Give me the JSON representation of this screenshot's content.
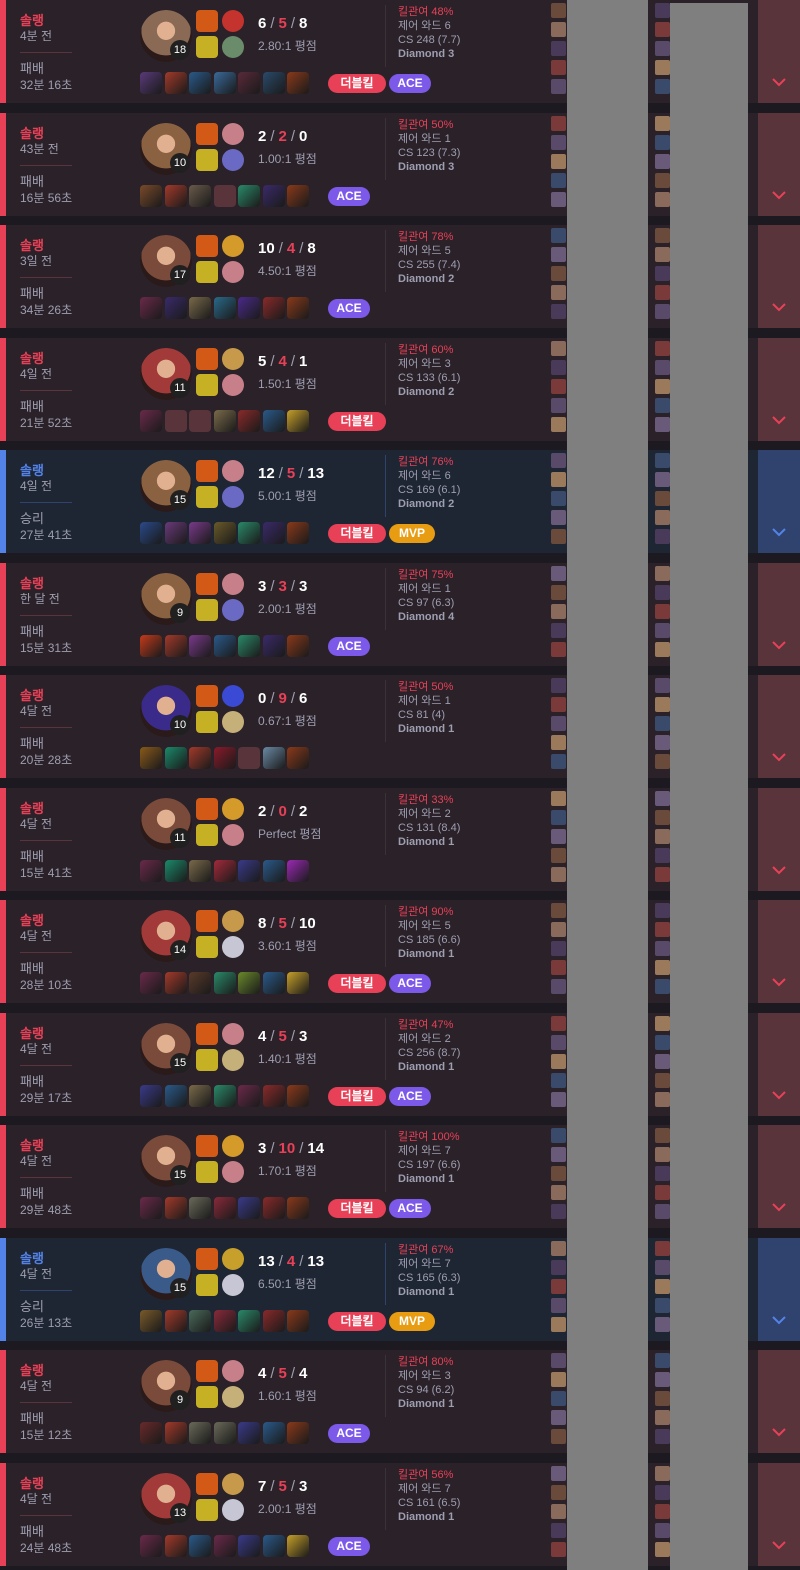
{
  "colors": {
    "loss": "#e84057",
    "win": "#5383e8",
    "kda_death": "#e84057",
    "ace_badge": "#7d59ea",
    "mvp_badge": "#e89c12"
  },
  "matches": [
    {
      "queue": "솔랭",
      "ago": "4분 전",
      "result": "패배",
      "win": false,
      "duration": "32분 16초",
      "champ_color": "#8a6a55",
      "champ_icon": "champion-portrait-icon",
      "level": "18",
      "kills": "6",
      "deaths": "5",
      "assists": "8",
      "ratio": "2.80:1 평점",
      "kill_part": "킬관여 48%",
      "wards": "제어 와드 6",
      "cs": "CS 248 (7.7)",
      "tier": "Diamond 3",
      "items": [
        "#5a3a7a",
        "#a33a2a",
        "#2a5a8a",
        "#3a6a9a",
        "#5a2a3a",
        "#2a4a6a",
        "#8a3a1a"
      ],
      "empty_items": [],
      "spells": [
        "#d25a16",
        "#c6b024"
      ],
      "runes": [
        "#c4332e",
        "#6b8c6a"
      ],
      "badges": [
        {
          "label": "더블킬",
          "style": "red"
        },
        {
          "label": "ACE",
          "style": "purple"
        }
      ]
    },
    {
      "queue": "솔랭",
      "ago": "43분 전",
      "result": "패배",
      "win": false,
      "duration": "16분 56초",
      "champ_color": "#8a6242",
      "champ_icon": "champion-portrait-icon",
      "level": "10",
      "kills": "2",
      "deaths": "2",
      "assists": "0",
      "ratio": "1.00:1 평점",
      "kill_part": "킬관여 50%",
      "wards": "제어 와드 1",
      "cs": "CS 123 (7.3)",
      "tier": "Diamond 3",
      "items": [
        "#7a4a2a",
        "#a33a2a",
        "#6a5a4a",
        null,
        "#2a8a6a",
        "#3a2a6a",
        "#8a3a1a"
      ],
      "empty_items": [
        3
      ],
      "spells": [
        "#d25a16",
        "#c6b024"
      ],
      "runes": [
        "#c7808a",
        "#6a6ac4"
      ],
      "badges": [
        {
          "label": "ACE",
          "style": "purple"
        }
      ]
    },
    {
      "queue": "솔랭",
      "ago": "3일 전",
      "result": "패배",
      "win": false,
      "duration": "34분 26초",
      "champ_color": "#7a4a3a",
      "champ_icon": "champion-portrait-icon",
      "level": "17",
      "kills": "10",
      "deaths": "4",
      "assists": "8",
      "ratio": "4.50:1 평점",
      "kill_part": "킬관여 78%",
      "wards": "제어 와드 5",
      "cs": "CS 255 (7.4)",
      "tier": "Diamond 2",
      "items": [
        "#6a2a4a",
        "#3a2a6a",
        "#7a6a4a",
        "#2a6a8a",
        "#4a2a8a",
        "#8a2a2a",
        "#8a3a1a"
      ],
      "empty_items": [],
      "spells": [
        "#d25a16",
        "#c6b024"
      ],
      "runes": [
        "#d49a2a",
        "#c7808a"
      ],
      "badges": [
        {
          "label": "ACE",
          "style": "purple"
        }
      ]
    },
    {
      "queue": "솔랭",
      "ago": "4일 전",
      "result": "패배",
      "win": false,
      "duration": "21분 52초",
      "champ_color": "#a33a3a",
      "champ_icon": "champion-portrait-icon",
      "level": "11",
      "kills": "5",
      "deaths": "4",
      "assists": "1",
      "ratio": "1.50:1 평점",
      "kill_part": "킬관여 60%",
      "wards": "제어 와드 3",
      "cs": "CS 133 (6.1)",
      "tier": "Diamond 2",
      "items": [
        "#6a2a4a",
        null,
        null,
        "#7a6a4a",
        "#8a2a2a",
        "#2a5a8a",
        "#c6a02a"
      ],
      "empty_items": [
        1,
        2
      ],
      "spells": [
        "#d25a16",
        "#c6b024"
      ],
      "runes": [
        "#c69a4a",
        "#c7808a"
      ],
      "badges": [
        {
          "label": "더블킬",
          "style": "red"
        }
      ]
    },
    {
      "queue": "솔랭",
      "ago": "4일 전",
      "result": "승리",
      "win": true,
      "duration": "27분 41초",
      "champ_color": "#8a6242",
      "champ_icon": "champion-portrait-icon",
      "level": "15",
      "kills": "12",
      "deaths": "5",
      "assists": "13",
      "ratio": "5.00:1 평점",
      "kill_part": "킬관여 76%",
      "wards": "제어 와드 6",
      "cs": "CS 169 (6.1)",
      "tier": "Diamond 2",
      "items": [
        "#2a4a8a",
        "#6a3a7a",
        "#7a3a8a",
        "#6a5a2a",
        "#2a8a6a",
        "#3a2a6a",
        "#8a3a1a"
      ],
      "empty_items": [],
      "spells": [
        "#d25a16",
        "#c6b024"
      ],
      "runes": [
        "#c7808a",
        "#6a6ac4"
      ],
      "badges": [
        {
          "label": "더블킬",
          "style": "red"
        },
        {
          "label": "MVP",
          "style": "gold"
        }
      ]
    },
    {
      "queue": "솔랭",
      "ago": "한 달 전",
      "result": "패배",
      "win": false,
      "duration": "15분 31초",
      "champ_color": "#8a6242",
      "champ_icon": "champion-portrait-icon",
      "level": "9",
      "kills": "3",
      "deaths": "3",
      "assists": "3",
      "ratio": "2.00:1 평점",
      "kill_part": "킬관여 75%",
      "wards": "제어 와드 1",
      "cs": "CS 97 (6.3)",
      "tier": "Diamond 4",
      "items": [
        "#c43a1a",
        "#a33a2a",
        "#7a3a8a",
        "#2a5a8a",
        "#2a8a6a",
        "#3a2a6a",
        "#8a3a1a"
      ],
      "empty_items": [],
      "spells": [
        "#d25a16",
        "#c6b024"
      ],
      "runes": [
        "#c7808a",
        "#6a6ac4"
      ],
      "badges": [
        {
          "label": "ACE",
          "style": "purple"
        }
      ]
    },
    {
      "queue": "솔랭",
      "ago": "4달 전",
      "result": "패배",
      "win": false,
      "duration": "20분 28초",
      "champ_color": "#3a2a8a",
      "champ_icon": "champion-portrait-icon",
      "level": "10",
      "kills": "0",
      "deaths": "9",
      "assists": "6",
      "ratio": "0.67:1 평점",
      "kill_part": "킬관여 50%",
      "wards": "제어 와드 1",
      "cs": "CS 81 (4)",
      "tier": "Diamond 1",
      "items": [
        "#8a5a1a",
        "#1a8a6a",
        "#a33a2a",
        "#8a1a2a",
        null,
        "#6a8aa4",
        "#8a3a1a"
      ],
      "empty_items": [
        4
      ],
      "spells": [
        "#d25a16",
        "#c6b024"
      ],
      "runes": [
        "#3a4ad4",
        "#c6b07a"
      ],
      "badges": []
    },
    {
      "queue": "솔랭",
      "ago": "4달 전",
      "result": "패배",
      "win": false,
      "duration": "15분 41초",
      "champ_color": "#7a4a3a",
      "champ_icon": "champion-portrait-icon",
      "level": "11",
      "kills": "2",
      "deaths": "0",
      "assists": "2",
      "ratio": "Perfect 평점",
      "kill_part": "킬관여 33%",
      "wards": "제어 와드 2",
      "cs": "CS 131 (8.4)",
      "tier": "Diamond 1",
      "items": [
        "#6a2a4a",
        "#1a8a6a",
        "#7a6a4a",
        "#a32a3a",
        "#3a3a8a",
        "#2a5a8a",
        "#9a2ab4"
      ],
      "empty_items": [],
      "spells": [
        "#d25a16",
        "#c6b024"
      ],
      "runes": [
        "#d49a2a",
        "#c7808a"
      ],
      "badges": []
    },
    {
      "queue": "솔랭",
      "ago": "4달 전",
      "result": "패배",
      "win": false,
      "duration": "28분 10초",
      "champ_color": "#a33a3a",
      "champ_icon": "champion-portrait-icon",
      "level": "14",
      "kills": "8",
      "deaths": "5",
      "assists": "10",
      "ratio": "3.60:1 평점",
      "kill_part": "킬관여 90%",
      "wards": "제어 와드 5",
      "cs": "CS 185 (6.6)",
      "tier": "Diamond 1",
      "items": [
        "#6a2a4a",
        "#a33a2a",
        "#5a3a2a",
        "#2a8a6a",
        "#6a8a2a",
        "#2a5a8a",
        "#c6a02a"
      ],
      "empty_items": [],
      "spells": [
        "#d25a16",
        "#c6b024"
      ],
      "runes": [
        "#c69a4a",
        "#c6c6d4"
      ],
      "badges": [
        {
          "label": "더블킬",
          "style": "red"
        },
        {
          "label": "ACE",
          "style": "purple"
        }
      ]
    },
    {
      "queue": "솔랭",
      "ago": "4달 전",
      "result": "패배",
      "win": false,
      "duration": "29분 17초",
      "champ_color": "#7a4a3a",
      "champ_icon": "champion-portrait-icon",
      "level": "15",
      "kills": "4",
      "deaths": "5",
      "assists": "3",
      "ratio": "1.40:1 평점",
      "kill_part": "킬관여 47%",
      "wards": "제어 와드 2",
      "cs": "CS 256 (8.7)",
      "tier": "Diamond 1",
      "items": [
        "#3a3a8a",
        "#2a5a8a",
        "#7a6a4a",
        "#2a8a6a",
        "#6a2a4a",
        "#8a2a2a",
        "#8a3a1a"
      ],
      "empty_items": [],
      "spells": [
        "#d25a16",
        "#c6b024"
      ],
      "runes": [
        "#c7808a",
        "#c6b07a"
      ],
      "badges": [
        {
          "label": "더블킬",
          "style": "red"
        },
        {
          "label": "ACE",
          "style": "purple"
        }
      ]
    },
    {
      "queue": "솔랭",
      "ago": "4달 전",
      "result": "패배",
      "win": false,
      "duration": "29분 48초",
      "champ_color": "#7a4a3a",
      "champ_icon": "champion-portrait-icon",
      "level": "15",
      "kills": "3",
      "deaths": "10",
      "assists": "14",
      "ratio": "1.70:1 평점",
      "kill_part": "킬관여 100%",
      "wards": "제어 와드 7",
      "cs": "CS 197 (6.6)",
      "tier": "Diamond 1",
      "items": [
        "#6a2a4a",
        "#a33a2a",
        "#6a6a5a",
        "#8a2a3a",
        "#3a3a8a",
        "#8a2a2a",
        "#8a3a1a"
      ],
      "empty_items": [],
      "spells": [
        "#d25a16",
        "#c6b024"
      ],
      "runes": [
        "#d49a2a",
        "#c7808a"
      ],
      "badges": [
        {
          "label": "더블킬",
          "style": "red"
        },
        {
          "label": "ACE",
          "style": "purple"
        }
      ]
    },
    {
      "queue": "솔랭",
      "ago": "4달 전",
      "result": "승리",
      "win": true,
      "duration": "26분 13초",
      "champ_color": "#3a5a8a",
      "champ_icon": "champion-portrait-icon",
      "level": "15",
      "kills": "13",
      "deaths": "4",
      "assists": "13",
      "ratio": "6.50:1 평점",
      "kill_part": "킬관여 67%",
      "wards": "제어 와드 7",
      "cs": "CS 165 (6.3)",
      "tier": "Diamond 1",
      "items": [
        "#7a5a2a",
        "#a33a2a",
        "#4a6a5a",
        "#8a2a3a",
        "#2a8a6a",
        "#8a2a2a",
        "#8a3a1a"
      ],
      "empty_items": [],
      "spells": [
        "#d25a16",
        "#c6b024"
      ],
      "runes": [
        "#c6a02a",
        "#c6c6d4"
      ],
      "badges": [
        {
          "label": "더블킬",
          "style": "red"
        },
        {
          "label": "MVP",
          "style": "gold"
        }
      ]
    },
    {
      "queue": "솔랭",
      "ago": "4달 전",
      "result": "패배",
      "win": false,
      "duration": "15분 12초",
      "champ_color": "#7a4a3a",
      "champ_icon": "champion-portrait-icon",
      "level": "9",
      "kills": "4",
      "deaths": "5",
      "assists": "4",
      "ratio": "1.60:1 평점",
      "kill_part": "킬관여 80%",
      "wards": "제어 와드 3",
      "cs": "CS 94 (6.2)",
      "tier": "Diamond 1",
      "items": [
        "#6a2a2a",
        "#a33a2a",
        "#6a6a5a",
        "#6a6a5a",
        "#3a3a8a",
        "#2a5a8a",
        "#8a3a1a"
      ],
      "empty_items": [],
      "spells": [
        "#d25a16",
        "#c6b024"
      ],
      "runes": [
        "#c7808a",
        "#c6b07a"
      ],
      "badges": [
        {
          "label": "ACE",
          "style": "purple"
        }
      ]
    },
    {
      "queue": "솔랭",
      "ago": "4달 전",
      "result": "패배",
      "win": false,
      "duration": "24분 48초",
      "champ_color": "#a33a3a",
      "champ_icon": "champion-portrait-icon",
      "level": "13",
      "kills": "7",
      "deaths": "5",
      "assists": "3",
      "ratio": "2.00:1 평점",
      "kill_part": "킬관여 56%",
      "wards": "제어 와드 7",
      "cs": "CS 161 (6.5)",
      "tier": "Diamond 1",
      "items": [
        "#6a2a4a",
        "#a33a2a",
        "#2a5a8a",
        "#6a2a4a",
        "#3a3a8a",
        "#2a5a8a",
        "#c6a02a"
      ],
      "empty_items": [],
      "spells": [
        "#d25a16",
        "#c6b024"
      ],
      "runes": [
        "#c69a4a",
        "#c6c6d4"
      ],
      "badges": [
        {
          "label": "ACE",
          "style": "purple"
        }
      ]
    }
  ]
}
